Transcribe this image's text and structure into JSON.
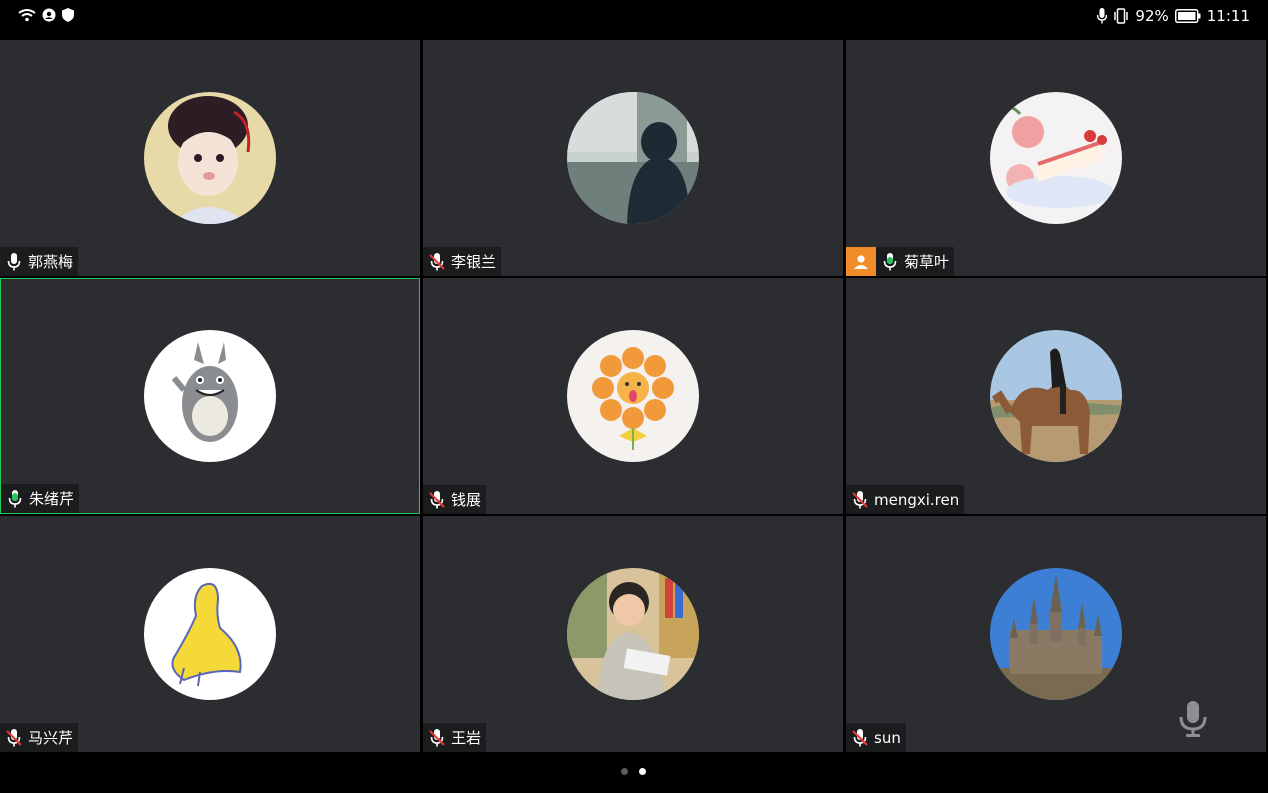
{
  "status_bar": {
    "battery_percent": "92%",
    "time": "11:11",
    "icons": [
      "wifi-icon",
      "location-icon",
      "shield-icon",
      "mic-icon",
      "vibrate-icon",
      "battery-icon"
    ]
  },
  "participants": [
    {
      "name": "郭燕梅",
      "mic": "unmuted",
      "avatar": "girl-illustration"
    },
    {
      "name": "李银兰",
      "mic": "muted",
      "avatar": "person-winter-photo"
    },
    {
      "name": "菊草叶",
      "mic": "speaking",
      "host": true,
      "avatar": "cake-illustration"
    },
    {
      "name": "朱绪芹",
      "mic": "speaking",
      "active": true,
      "avatar": "totoro-drawing"
    },
    {
      "name": "钱展",
      "mic": "muted",
      "avatar": "fruit-flower"
    },
    {
      "name": "mengxi.ren",
      "mic": "muted",
      "avatar": "camel-photo"
    },
    {
      "name": "马兴芹",
      "mic": "muted",
      "avatar": "yellow-dress-drawing"
    },
    {
      "name": "王岩",
      "mic": "muted",
      "avatar": "child-reading-photo"
    },
    {
      "name": "sun",
      "mic": "muted",
      "avatar": "castle-photo"
    }
  ],
  "pager": {
    "pages": 2,
    "current": 2
  },
  "colors": {
    "tile_bg": "#2b2d30",
    "speaking": "#22c55e",
    "muted": "#e53935",
    "host_badge": "#f28c28"
  }
}
